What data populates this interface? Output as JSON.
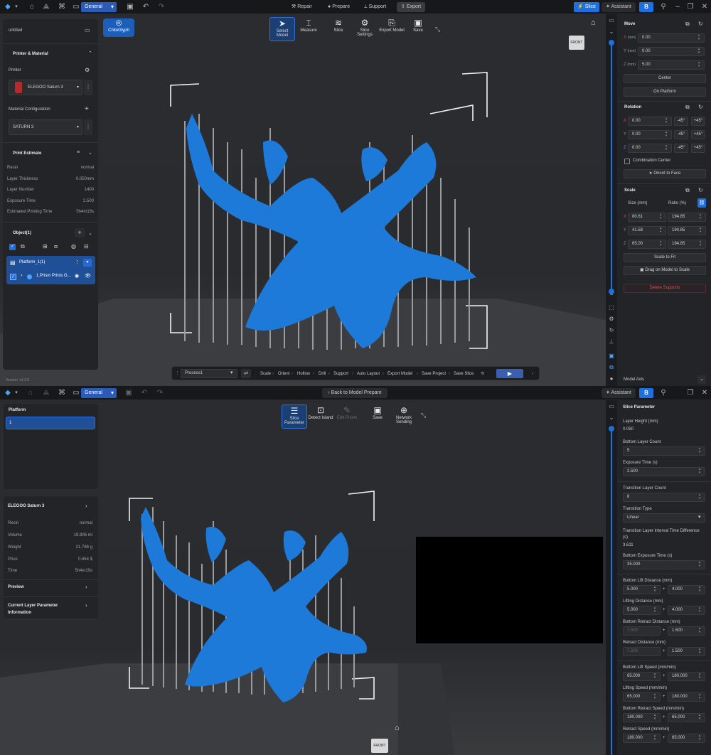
{
  "top": {
    "menubar": {
      "mode_dropdown": "General",
      "tabs": [
        "Repair",
        "Prepare",
        "Support",
        "Export"
      ],
      "slice_button": "Slice",
      "assistant_button": "Assistant",
      "avatar_letter": "B"
    },
    "left": {
      "file_name": "untitled",
      "printer_material_title": "Printer & Material",
      "printer_label": "Printer",
      "printer_value": "ELEGOO Saturn 3",
      "material_config_label": "Material Configuration",
      "material_value": "SATURN 3",
      "print_estimate_title": "Print Estimate",
      "estimate_rows": [
        {
          "label": "Resin",
          "value": "normal"
        },
        {
          "label": "Layer Thickness",
          "value": "0.050mm"
        },
        {
          "label": "Layer Number",
          "value": "1400"
        },
        {
          "label": "Exposure Time",
          "value": "2.500"
        },
        {
          "label": "Estimated Printing Time",
          "value": "5h4m19s"
        }
      ],
      "objects_title": "Object(1)",
      "platform_item": "Platform_1(1)",
      "object_item": "1.Prism Prints G...",
      "version": "Version: v1.2.0"
    },
    "toolbar": {
      "logo_label": "ChituGlyph",
      "tools": [
        "Select Model",
        "Measure",
        "Slice",
        "Slice Settings",
        "Export Model",
        "Save"
      ]
    },
    "view_cube_label": "FRONT",
    "bottom_bar": {
      "process": "Process1",
      "steps": [
        "Scale",
        "Orient",
        "Hollow",
        "Drill",
        "Support",
        "Auto Layout",
        "Export Model",
        "Save Project",
        "Save Slice"
      ]
    },
    "right": {
      "move_title": "Move",
      "move_axes": [
        {
          "axis": "X",
          "unit": "(mm)",
          "value": "0.00"
        },
        {
          "axis": "Y",
          "unit": "(mm)",
          "value": "0.00"
        },
        {
          "axis": "Z",
          "unit": "(mm)",
          "value": "5.00"
        }
      ],
      "center_button": "Center",
      "on_platform_button": "On Platform",
      "rotation_title": "Rotation",
      "rotation_axes": [
        {
          "axis": "X",
          "value": "0.00"
        },
        {
          "axis": "Y",
          "value": "0.00"
        },
        {
          "axis": "Z",
          "value": "0.00"
        }
      ],
      "minus45": "-45°",
      "plus45": "+45°",
      "combination_center": "Combination Center",
      "orient_to_face": "Orient to Face",
      "scale_title": "Scale",
      "size_header": "Size (mm)",
      "ratio_header": "Ratio (%)",
      "scale_rows": [
        {
          "axis": "X",
          "size": "80.61",
          "ratio": "194.85"
        },
        {
          "axis": "Y",
          "size": "41.58",
          "ratio": "194.85"
        },
        {
          "axis": "Z",
          "size": "65.00",
          "ratio": "194.85"
        }
      ],
      "scale_to_fit": "Scale to Fit",
      "drag_scale": "Drag on Model to Scale",
      "delete_supports": "Delete Supports",
      "model_axis": "Model Axis"
    }
  },
  "bottom": {
    "menubar": {
      "mode_dropdown": "General",
      "back_button": "Back to Model Prepare",
      "assistant_button": "Assistant",
      "avatar_letter": "B"
    },
    "left": {
      "platform_title": "Platform",
      "platform_selected": "1",
      "printer_name": "ELEGOO Saturn 3",
      "info_rows": [
        {
          "label": "Resin",
          "value": "normal"
        },
        {
          "label": "Volume",
          "value": "19.806 ml"
        },
        {
          "label": "Weight",
          "value": "21.786 g"
        },
        {
          "label": "Price",
          "value": "0.654 $"
        },
        {
          "label": "Time",
          "value": "5h4m19s"
        }
      ],
      "preview_label": "Preview",
      "current_layer_label_1": "Current Layer Parameter",
      "current_layer_label_2": "Information"
    },
    "toolbar": {
      "tools": [
        "Slice Parameter",
        "Detect Island",
        "Edit Pixels",
        "Save",
        "Network Sending"
      ]
    },
    "view_cube_label": "FRONT",
    "right": {
      "title": "Slice Parameter",
      "layer_height_label": "Layer Height (mm)",
      "layer_height_value": "0.050",
      "bottom_layer_count_label": "Bottom Layer Count",
      "bottom_layer_count_value": "5",
      "exposure_time_label": "Exposure Time (s)",
      "exposure_time_value": "2.500",
      "transition_layer_count_label": "Transition Layer Count",
      "transition_layer_count_value": "6",
      "transition_type_label": "Transition Type",
      "transition_type_value": "Linear",
      "interval_label_1": "Transition Layer Interval Time Difference",
      "interval_label_2": "(s)",
      "interval_value": "3.611",
      "bottom_exposure_label": "Bottom Exposure Time (s)",
      "bottom_exposure_value": "35.000",
      "bottom_lift_label": "Bottom Lift Distance (mm)",
      "bottom_lift_a": "5.000",
      "bottom_lift_b": "4.000",
      "lifting_distance_label": "Lifting Distance (mm)",
      "lifting_distance_a": "5.000",
      "lifting_distance_b": "4.000",
      "bottom_retract_label": "Bottom Retract Distance (mm)",
      "bottom_retract_a": "7.500",
      "bottom_retract_b": "1.500",
      "retract_distance_label": "Retract Distance  (mm)",
      "retract_distance_a": "7.500",
      "retract_distance_b": "1.500",
      "bottom_lift_speed_label": "Bottom Lift Speed  (mm/min)",
      "bottom_lift_speed_a": "65.000",
      "bottom_lift_speed_b": "180.000",
      "lifting_speed_label": "Lifting Speed  (mm/min)",
      "lifting_speed_a": "65.000",
      "lifting_speed_b": "180.000",
      "bottom_retract_speed_label": "Bottom Retract Speed  (mm/min)",
      "bottom_retract_speed_a": "180.000",
      "bottom_retract_speed_b": "65.000",
      "retract_speed_label": "Retract Speed  (mm/min)",
      "retract_speed_a": "180.000",
      "retract_speed_b": "65.000",
      "plus": "+"
    }
  }
}
